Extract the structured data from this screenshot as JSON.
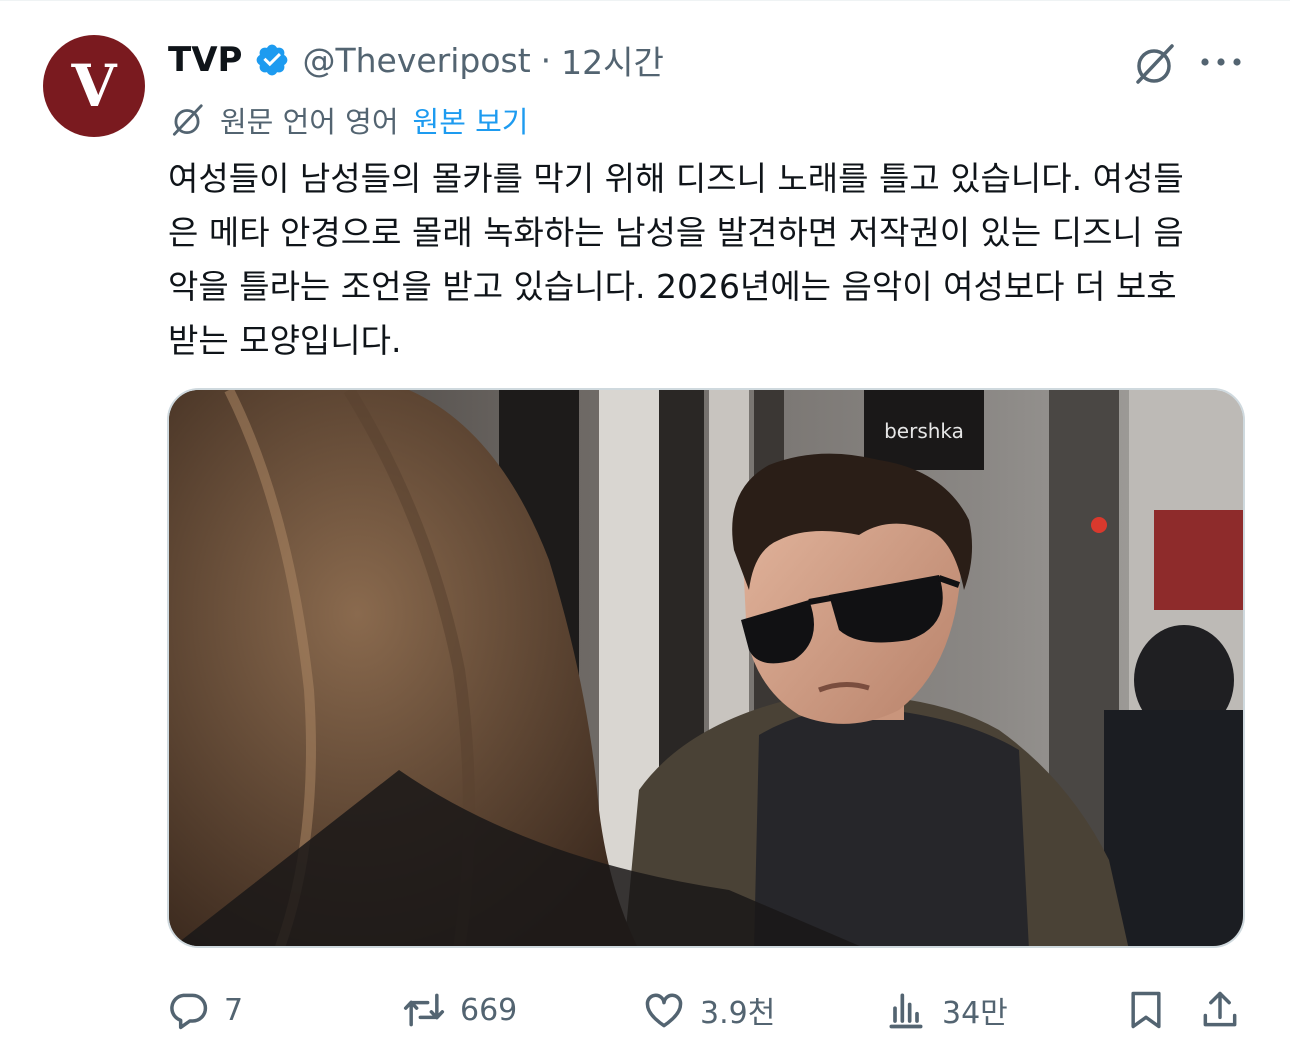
{
  "tweet": {
    "author_name": "TVP",
    "avatar_letter": "V",
    "handle": "@Theveripost",
    "separator": "·",
    "time": "12시간",
    "translation_note": "원문 언어 영어",
    "view_original": "원본 보기",
    "text": "여성들이 남성들의 몰카를 막기 위해 디즈니 노래를 틀고 있습니다. 여성들\n은 메타 안경으로 몰래 녹화하는 남성을 발견하면 저작권이 있는 디즈니 음\n악을 틀라는 조언을 받고 있습니다. 2026년에는 음악이 여성보다 더 보호\n받는 모양입니다.",
    "sign_text": "bershka"
  },
  "actions": {
    "reply_count": "7",
    "retweet_count": "669",
    "like_count": "3.9천",
    "view_count": "34만"
  },
  "colors": {
    "avatar_bg": "#7a1a1f",
    "verified": "#1d9bf0",
    "link": "#1d9bf0",
    "secondary_text": "#536471"
  },
  "icons": [
    "verified-badge-icon",
    "grok-icon",
    "more-icon",
    "translate-icon",
    "reply-icon",
    "retweet-icon",
    "like-icon",
    "views-icon",
    "bookmark-icon",
    "share-icon"
  ]
}
